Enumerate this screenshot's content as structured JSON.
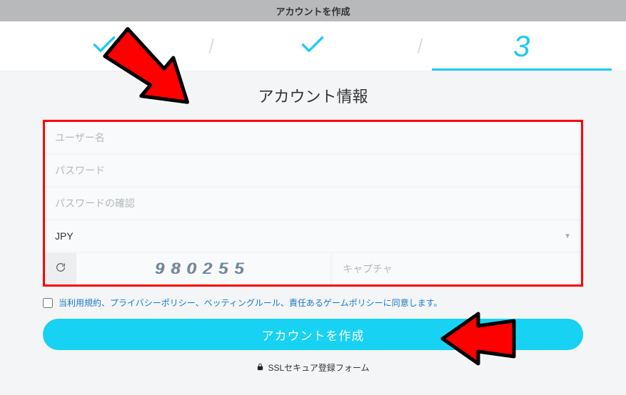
{
  "header": {
    "title": "アカウントを作成"
  },
  "steps": {
    "num3": "3"
  },
  "form": {
    "section_title": "アカウント情報",
    "username_ph": "ユーザー名",
    "password_ph": "パスワード",
    "password_confirm_ph": "パスワードの確認",
    "currency_value": "JPY",
    "captcha_code": "980255",
    "captcha_ph": "キャプチャ"
  },
  "agree": {
    "text": "当利用規約、プライバシーポリシー、ベッティングルール、責任あるゲームポリシーに同意します。"
  },
  "submit": {
    "label": "アカウントを作成"
  },
  "ssl": {
    "text": "SSLセキュア登録フォーム"
  }
}
